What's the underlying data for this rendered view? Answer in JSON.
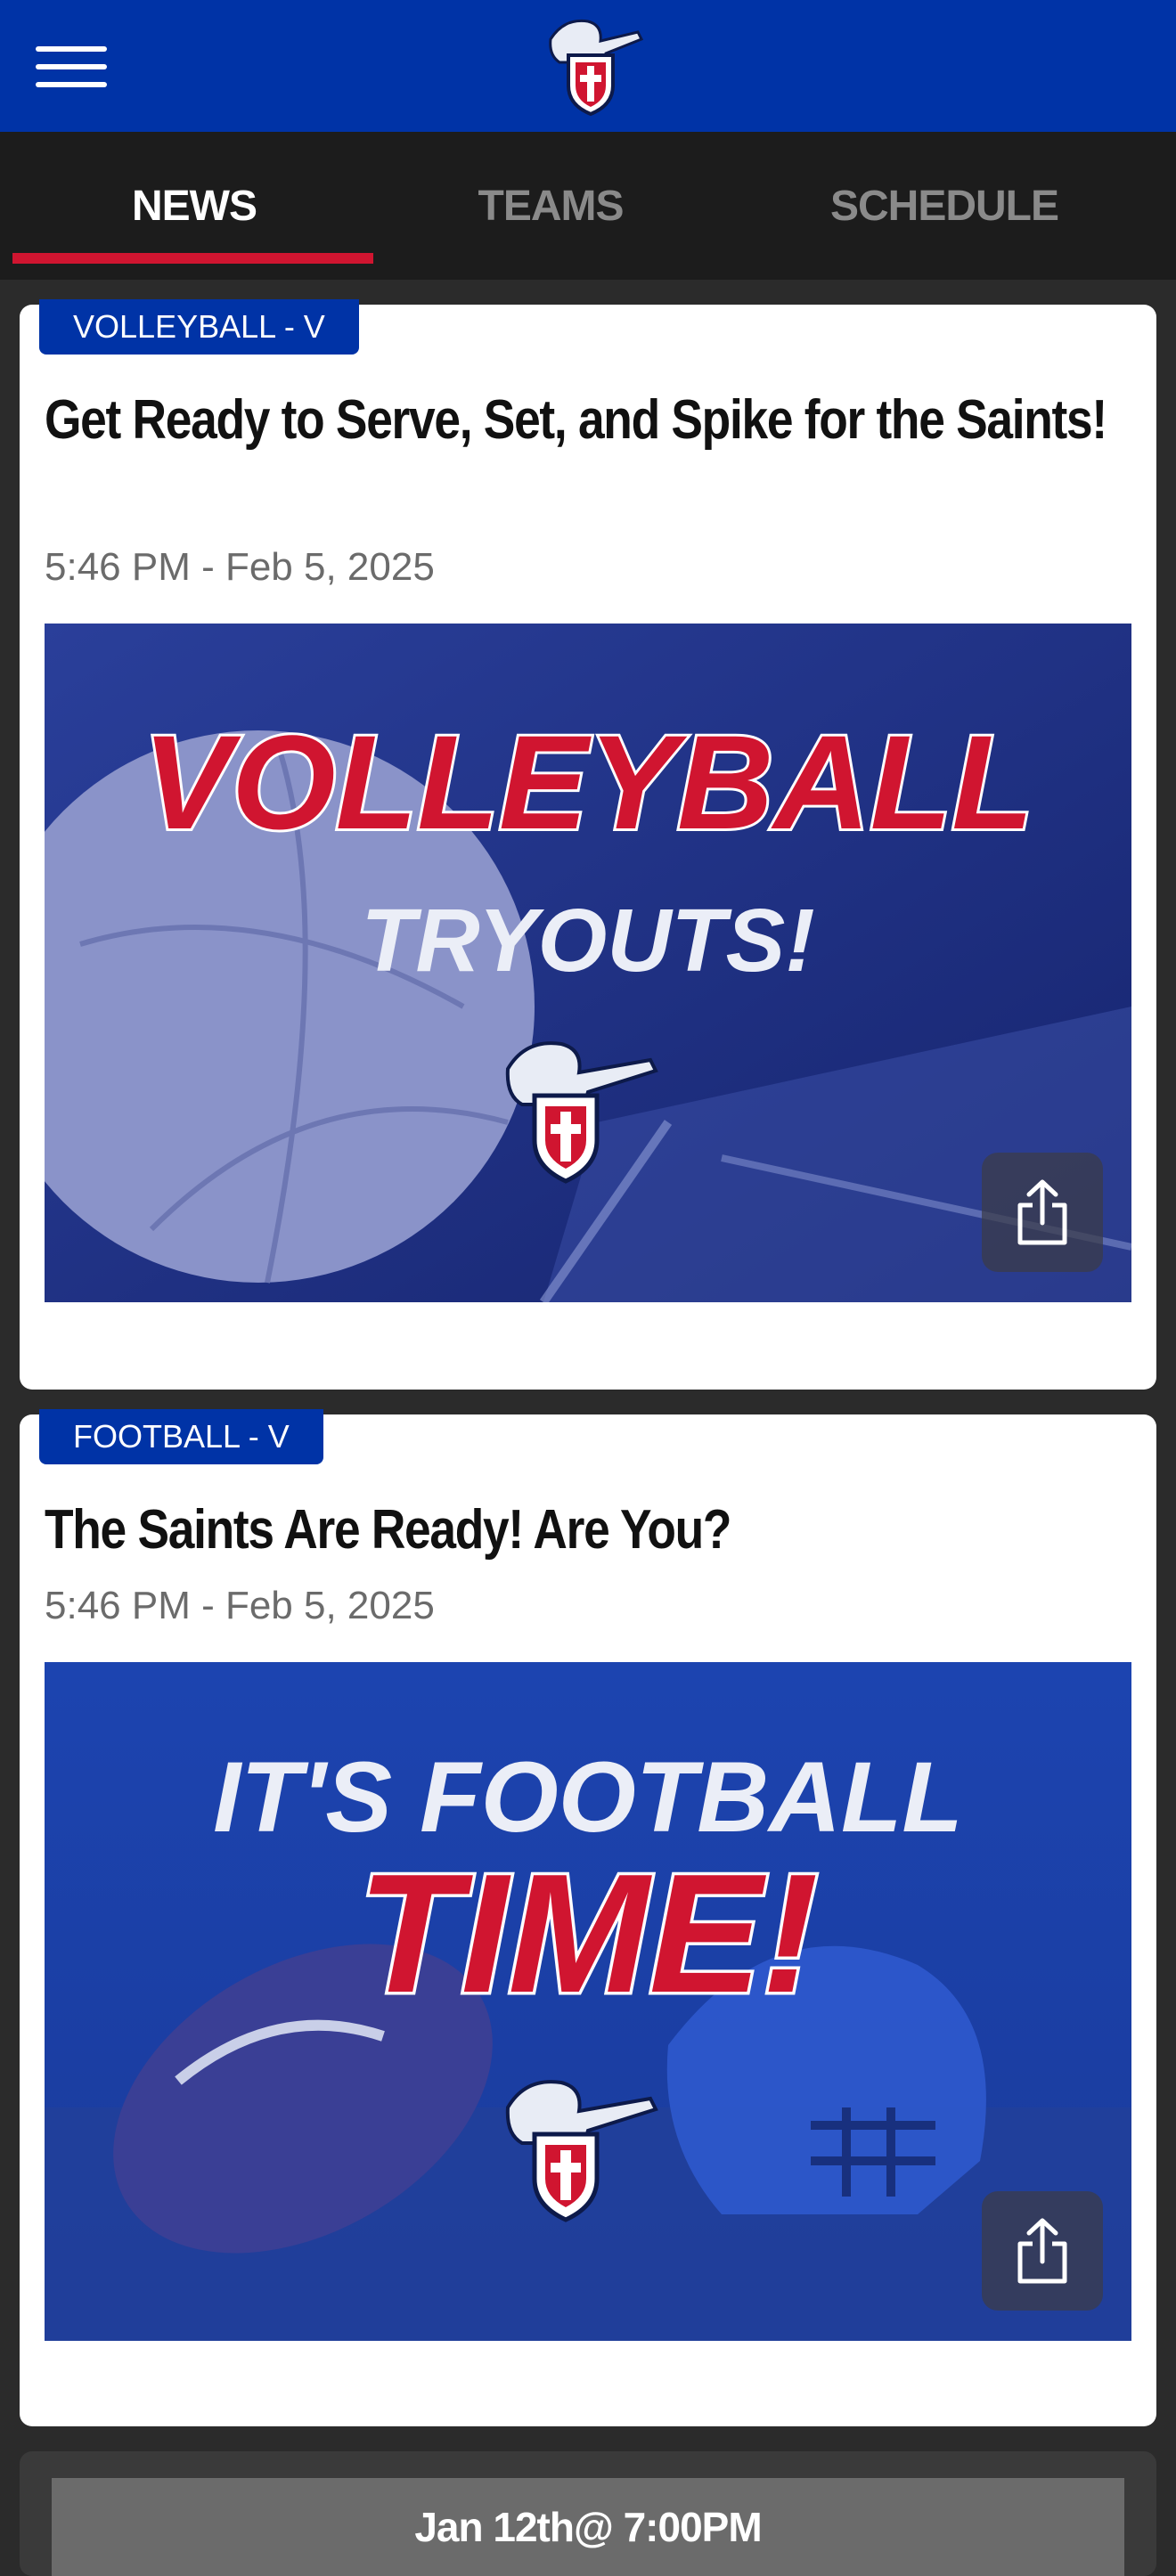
{
  "header": {
    "menu_icon": "hamburger-menu-icon",
    "logo_icon": "saints-knight-logo"
  },
  "tabs": [
    {
      "label": "NEWS",
      "active": true
    },
    {
      "label": "TEAMS",
      "active": false
    },
    {
      "label": "SCHEDULE",
      "active": false
    }
  ],
  "news": [
    {
      "badge": "VOLLEYBALL - V",
      "title": "Get Ready to Serve, Set, and Spike for the Saints!",
      "timestamp": "5:46 PM - Feb 5, 2025",
      "image": {
        "line1": "VOLLEYBALL",
        "line2": "TRYOUTS!"
      },
      "share_icon": "share-icon"
    },
    {
      "badge": "FOOTBALL - V",
      "title": "The Saints Are Ready! Are You?",
      "timestamp": "5:46 PM - Feb 5, 2025",
      "image": {
        "line1": "IT'S FOOTBALL",
        "line2": "TIME!"
      },
      "share_icon": "share-icon"
    }
  ],
  "partial_card": {
    "text": "Jan 12th@ 7:00PM"
  },
  "colors": {
    "brand_blue": "#0033a6",
    "accent_red": "#d01530",
    "tab_bar": "#1c1c1c"
  }
}
